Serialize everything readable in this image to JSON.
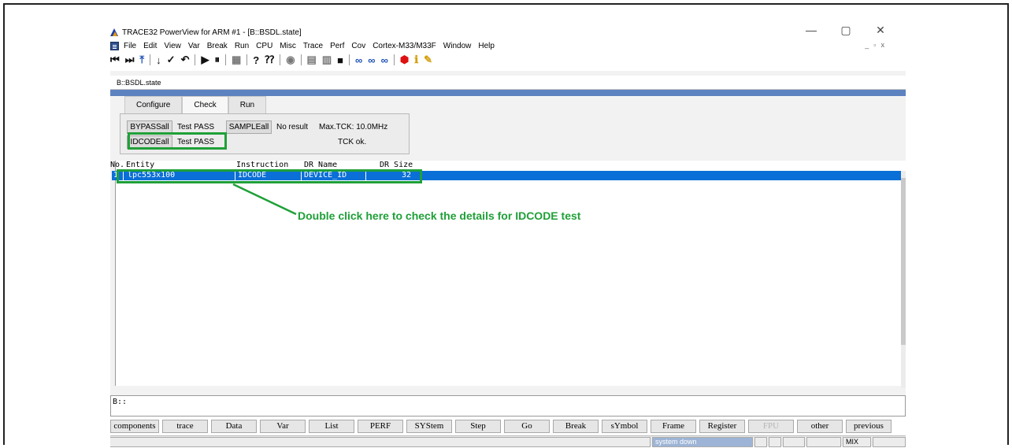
{
  "window": {
    "title": "TRACE32 PowerView for ARM #1 - [B::BSDL.state]",
    "controls": [
      "—",
      "▢",
      "✕"
    ],
    "mdi_controls": [
      "_",
      "▫",
      "x"
    ]
  },
  "menu": [
    "File",
    "Edit",
    "View",
    "Var",
    "Break",
    "Run",
    "CPU",
    "Misc",
    "Trace",
    "Perf",
    "Cov",
    "Cortex-M33/M33F",
    "Window",
    "Help"
  ],
  "toolbar_icons": [
    "step-into-icon",
    "step-over-icon",
    "up-icon",
    "down-icon",
    "check-icon",
    "return-icon",
    "go-icon",
    "pause-icon",
    "windows-icon",
    "help-icon",
    "context-help-icon",
    "stop-icon",
    "list-icon",
    "memory-icon",
    "register-icon",
    "trace-icon",
    "trace2-icon",
    "trace3-icon",
    "breakpoint-icon",
    "info-icon",
    "settings-icon"
  ],
  "panel": {
    "title": "B::BSDL.state",
    "tabs": [
      "Configure",
      "Check",
      "Run"
    ],
    "active_tab": "Check",
    "buttons": {
      "bypass": "BYPASSall",
      "sample": "SAMPLEall",
      "idcode": "IDCODEall"
    },
    "results": {
      "bypass": "Test PASS",
      "sample": "No result",
      "idcode": "Test PASS",
      "max_tck": "Max.TCK: 10.0MHz",
      "tck_ok": "TCK ok."
    }
  },
  "table": {
    "headers": {
      "no": "No.",
      "entity": "Entity",
      "instruction": "Instruction",
      "dr_name": "DR Name",
      "dr_size": "DR Size"
    },
    "rows": [
      {
        "no": "1",
        "entity": "lpc553x100",
        "instruction": "IDCODE",
        "dr_name": "DEVICE_ID",
        "dr_size": "32"
      }
    ]
  },
  "annotation": "Double click here to check the details for IDCODE test",
  "command_line": {
    "prompt": "B::"
  },
  "softkeys": [
    "components",
    "trace",
    "Data",
    "Var",
    "List",
    "PERF",
    "SYStem",
    "Step",
    "Go",
    "Break",
    "sYmbol",
    "Frame",
    "Register",
    "FPU",
    "other",
    "previous"
  ],
  "status": {
    "state": "system down",
    "mode": "MIX"
  },
  "colors": {
    "highlight": "#1fa038",
    "selection": "#0a6fd6",
    "title_bar": "#5d82c0"
  }
}
